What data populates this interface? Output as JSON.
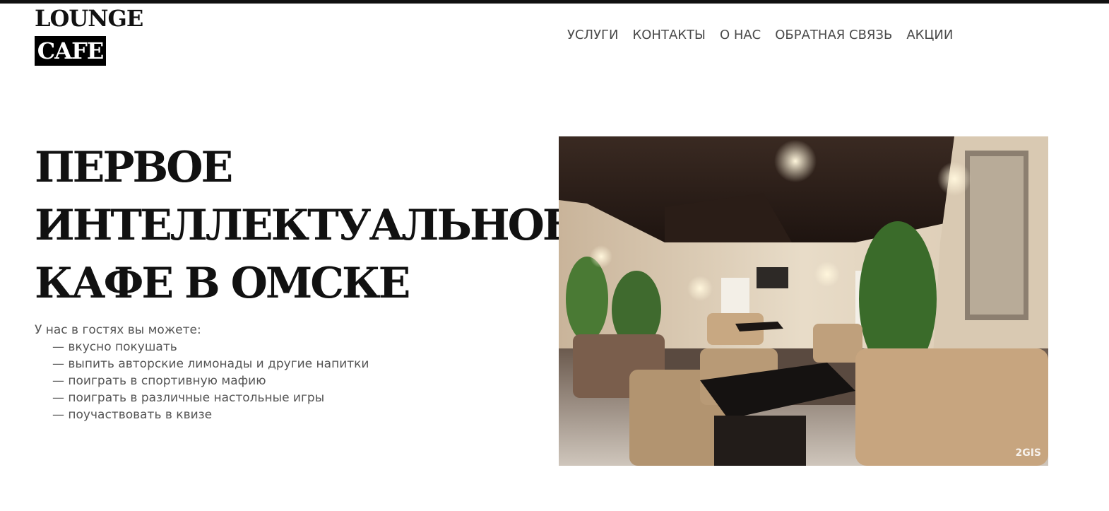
{
  "logo": {
    "line1": "LOUNGE",
    "line2": "CAFE"
  },
  "nav": {
    "items": [
      {
        "label": "УСЛУГИ"
      },
      {
        "label": "КОНТАКТЫ"
      },
      {
        "label": "О НАС"
      },
      {
        "label": "ОБРАТНАЯ СВЯЗЬ"
      },
      {
        "label": "АКЦИИ"
      }
    ]
  },
  "hero": {
    "title_lines": [
      "ПЕРВОЕ",
      "ИНТЕЛЛЕКТУАЛЬНОЕ",
      "КАФЕ В ОМСКЕ"
    ],
    "intro": "У нас в гостях вы можете:",
    "features": [
      "— вкусно покушать",
      "— выпить авторские лимонады и другие напитки",
      "— поиграть в спортивную мафию",
      "— поиграть в различные настольные игры",
      "— поучаствовать в квизе"
    ],
    "photo_watermark": "2GIS"
  },
  "colors": {
    "text": "#111111",
    "nav_text": "#4a4a4a",
    "body_text": "#555555",
    "logo_bg": "#000000"
  }
}
